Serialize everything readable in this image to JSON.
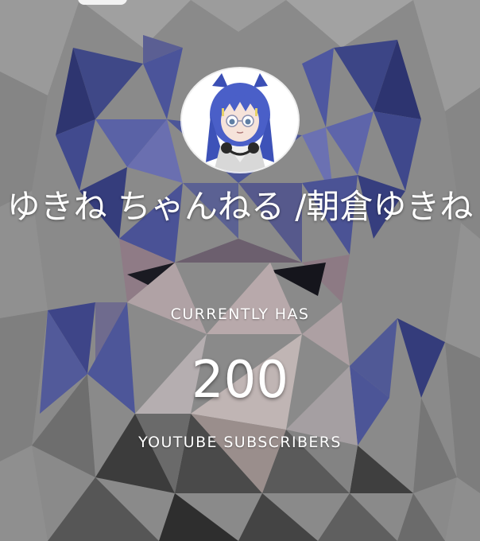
{
  "channel": {
    "name": "ゆきね ちゃんねる /朝倉ゆきね",
    "avatar_icon": "channel-avatar-icon"
  },
  "stats": {
    "prefix_label": "CURRENTLY HAS",
    "subscriber_count": "200",
    "suffix_label": "YOUTUBE SUBSCRIBERS"
  },
  "colors": {
    "background_base": "#8c8c8c",
    "accent_blue": "#3f4a8c",
    "text": "#ffffff"
  }
}
